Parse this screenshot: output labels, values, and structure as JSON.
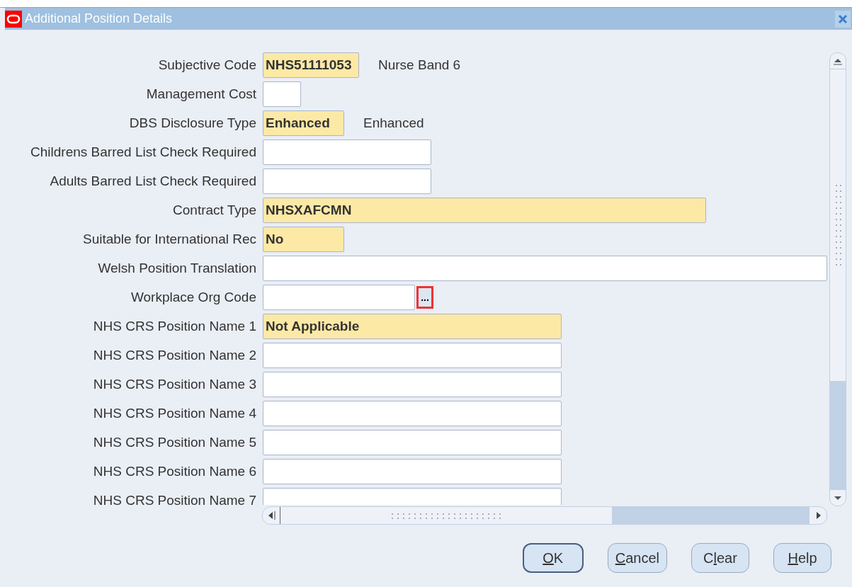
{
  "window": {
    "title": "Additional Position Details"
  },
  "fields": [
    {
      "label": "Subjective Code",
      "value": "NHS51111053",
      "required": true,
      "kind": "code",
      "description": "Nurse Band 6"
    },
    {
      "label": "Management Cost",
      "required": false,
      "kind": "tiny"
    },
    {
      "label": "DBS Disclosure Type",
      "value": "Enhanced",
      "required": true,
      "kind": "short",
      "description": "Enhanced"
    },
    {
      "label": "Childrens Barred List Check Required",
      "required": false,
      "kind": "medium"
    },
    {
      "label": "Adults Barred List Check Required",
      "required": false,
      "kind": "medium"
    },
    {
      "label": "Contract Type",
      "value": "NHSXAFCMN",
      "required": true,
      "kind": "wide"
    },
    {
      "label": "Suitable for International Rec",
      "value": "No",
      "required": true,
      "kind": "short"
    },
    {
      "label": "Welsh Position Translation",
      "required": false,
      "kind": "full"
    },
    {
      "label": "Workplace Org Code",
      "required": false,
      "kind": "lov",
      "lov_button": "..."
    },
    {
      "label": "NHS CRS Position Name 1",
      "value": "Not Applicable",
      "required": true,
      "kind": "long"
    },
    {
      "label": "NHS CRS Position Name 2",
      "required": false,
      "kind": "long"
    },
    {
      "label": "NHS CRS Position Name 3",
      "required": false,
      "kind": "long"
    },
    {
      "label": "NHS CRS Position Name 4",
      "required": false,
      "kind": "long"
    },
    {
      "label": "NHS CRS Position Name 5",
      "required": false,
      "kind": "long"
    },
    {
      "label": "NHS CRS Position Name 6",
      "required": false,
      "kind": "long"
    },
    {
      "label": "NHS CRS Position Name 7",
      "required": false,
      "kind": "long"
    }
  ],
  "buttons": [
    {
      "access_key": "O",
      "label_rest": "K",
      "default": true
    },
    {
      "access_key": "C",
      "label_rest": "ancel",
      "default": false
    },
    {
      "label_start": "C",
      "access_key": "l",
      "label_rest": "ear",
      "default": false
    },
    {
      "access_key": "H",
      "label_rest": "elp",
      "default": false
    }
  ]
}
